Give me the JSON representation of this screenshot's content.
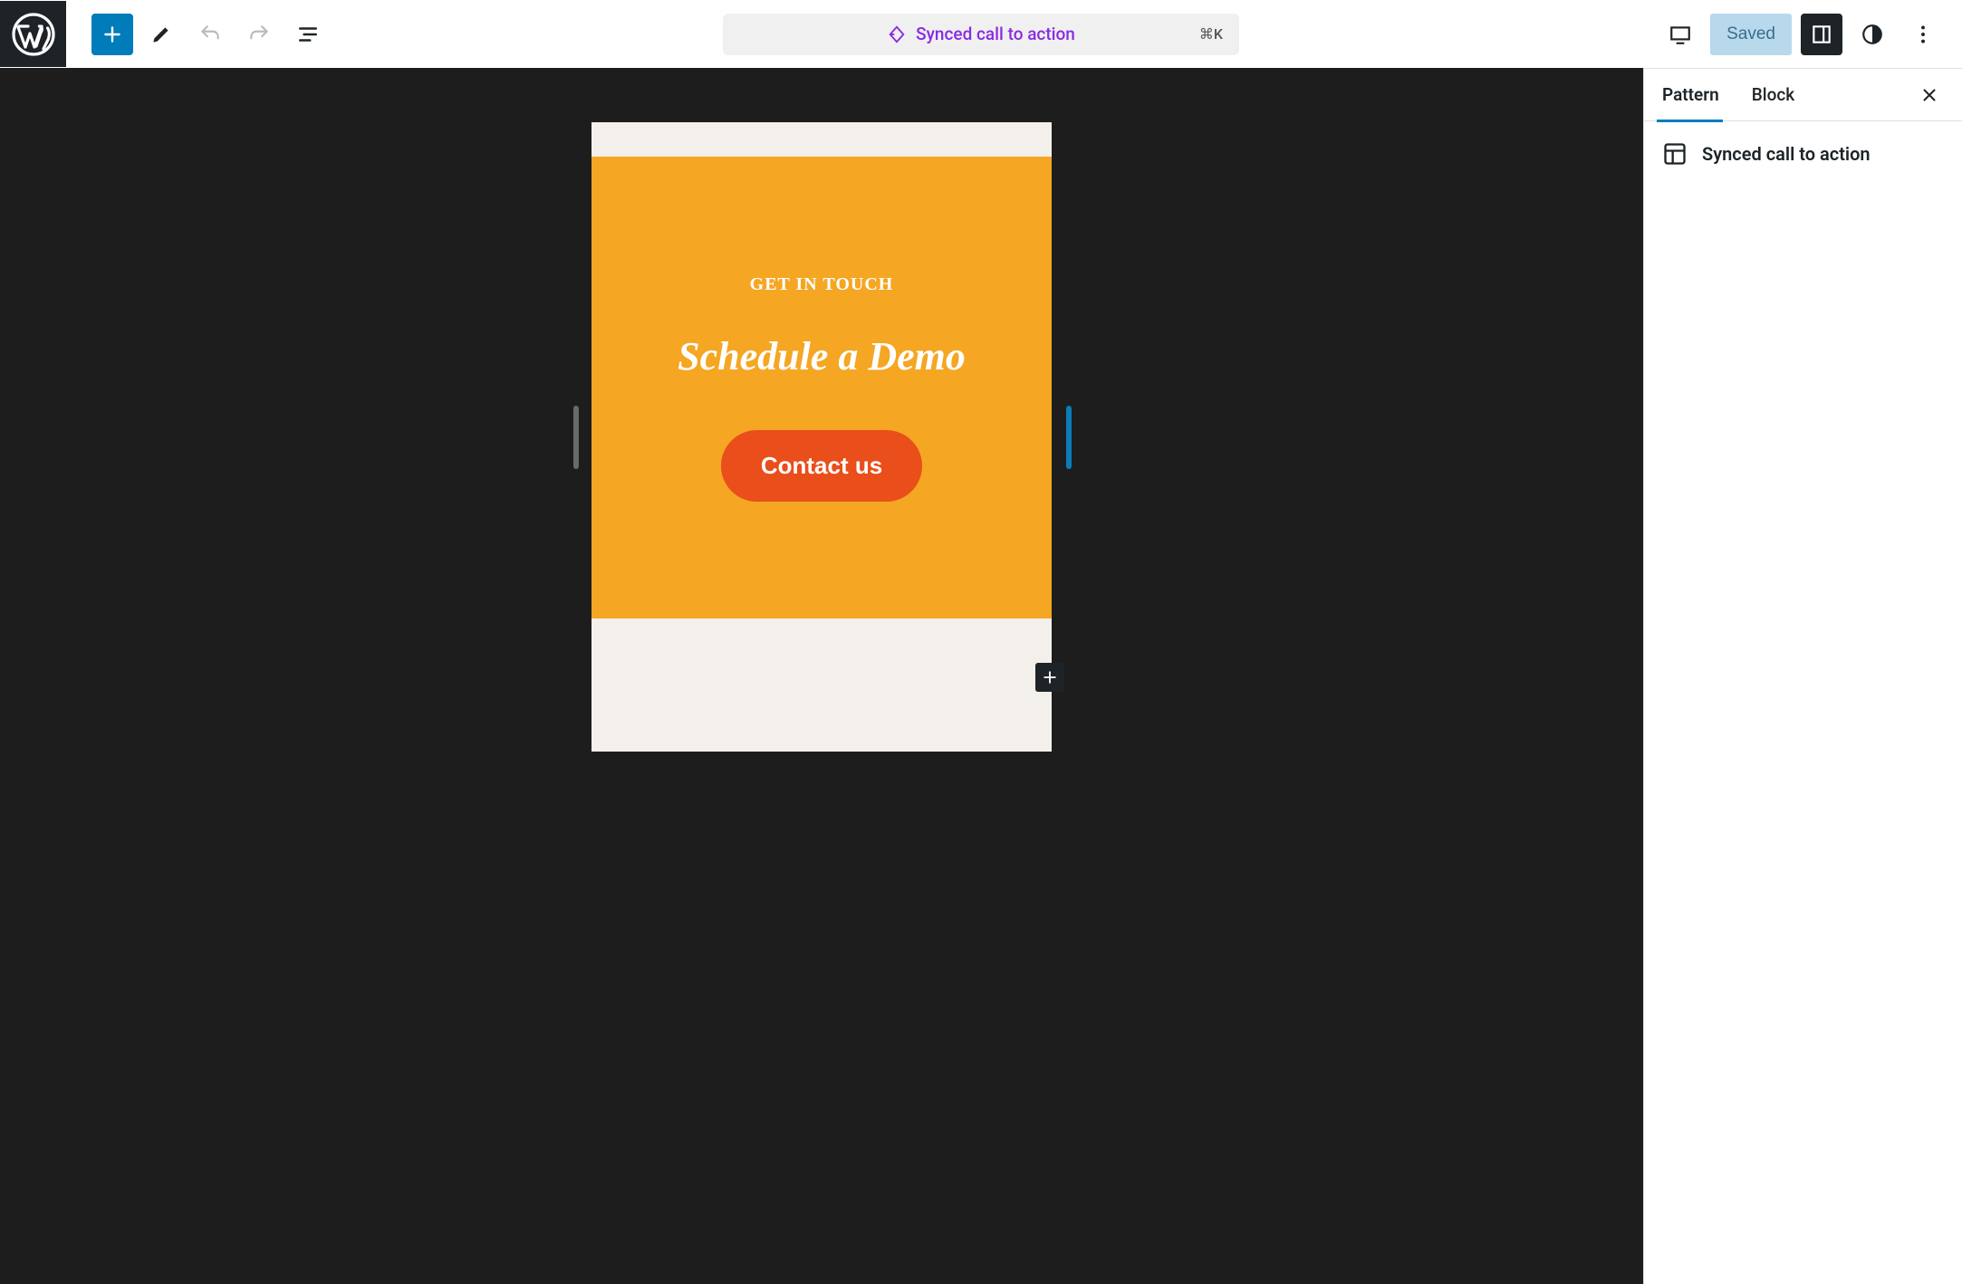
{
  "toolbar": {
    "center_title": "Synced call to action",
    "shortcut": "⌘K",
    "saved_label": "Saved"
  },
  "sidebar": {
    "tabs": {
      "pattern": "Pattern",
      "block": "Block"
    },
    "pattern_title": "Synced call to action"
  },
  "canvas": {
    "eyebrow": "GET IN TOUCH",
    "heading": "Schedule a Demo",
    "button": "Contact us"
  }
}
